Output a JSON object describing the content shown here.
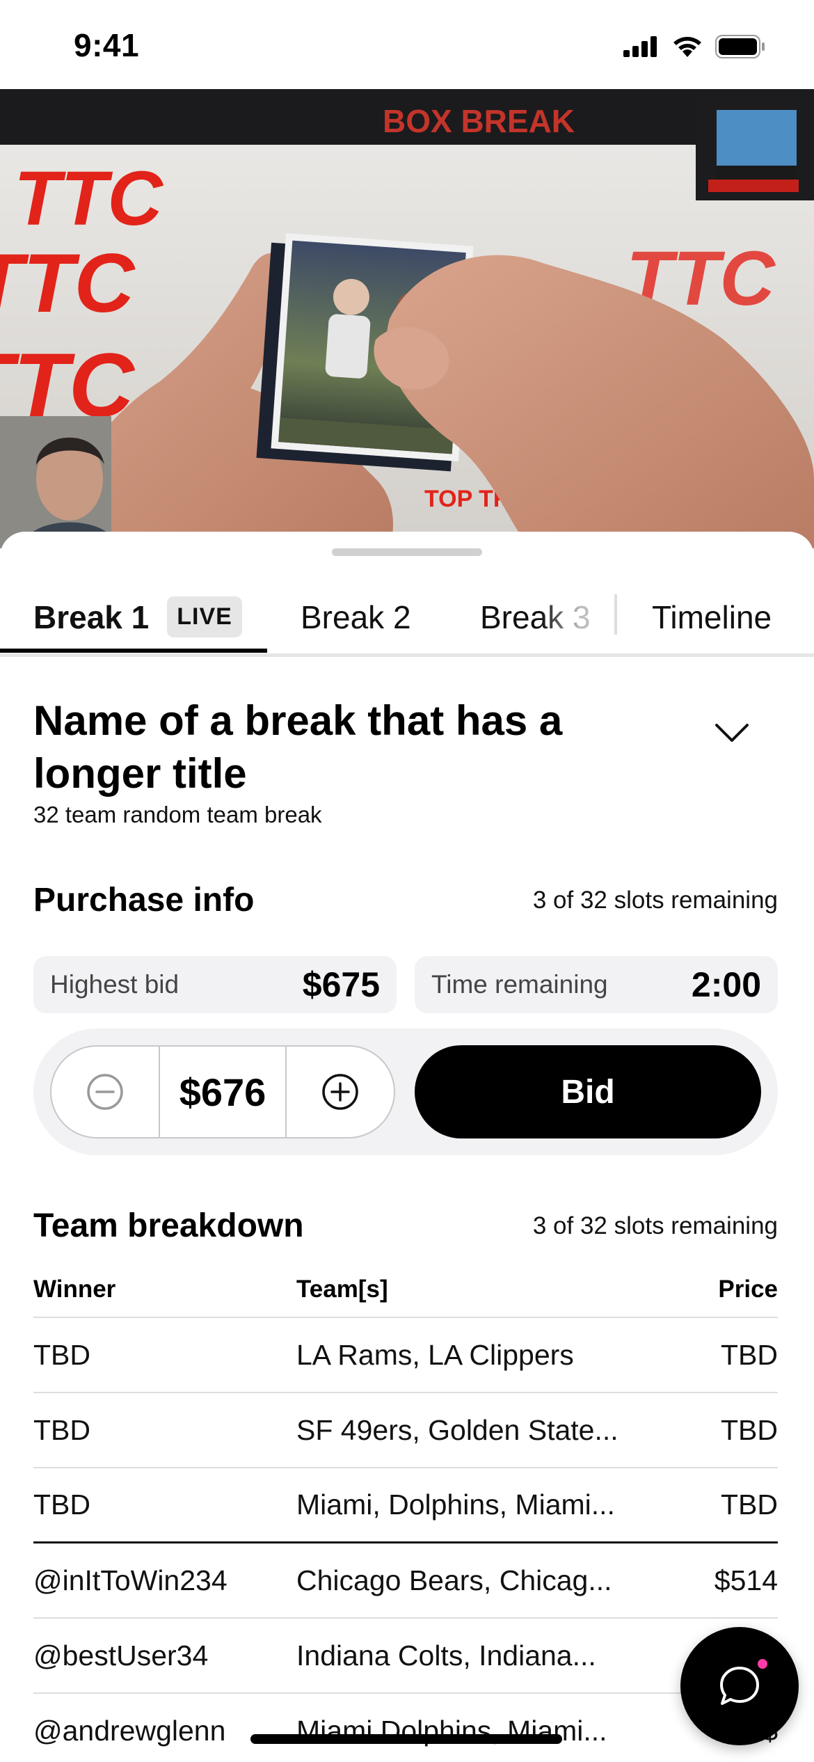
{
  "status_bar": {
    "time": "9:41",
    "icons": [
      "cellular-signal-icon",
      "wifi-icon",
      "battery-icon"
    ]
  },
  "video": {
    "description_icons": [
      "streamer-avatar",
      "product-box-thumbnail"
    ],
    "overlay_text": {
      "banner": "BOX BREAK",
      "logo": "TTC",
      "tagline": "TOP TRADING CARDS"
    }
  },
  "tabs": [
    {
      "label": "Break 1",
      "badge": "LIVE",
      "active": true
    },
    {
      "label": "Break 2",
      "active": false
    },
    {
      "label": "Break 3",
      "active": false
    },
    {
      "label": "Timeline",
      "active": false
    }
  ],
  "break": {
    "title": "Name of a break that has a longer title",
    "subtitle": "32 team random team break"
  },
  "purchase": {
    "title": "Purchase info",
    "slots": "3 of 32 slots remaining",
    "highest_bid_label": "Highest bid",
    "highest_bid_value": "$675",
    "time_label": "Time remaining",
    "time_value": "2:00",
    "bid_amount": "$676",
    "bid_button": "Bid"
  },
  "breakdown": {
    "title": "Team breakdown",
    "slots": "3 of 32 slots remaining",
    "columns": [
      "Winner",
      "Team[s]",
      "Price"
    ],
    "rows": [
      [
        "TBD",
        "LA Rams, LA Clippers",
        "TBD"
      ],
      [
        "TBD",
        "SF 49ers, Golden State...",
        "TBD"
      ],
      [
        "TBD",
        "Miami, Dolphins, Miami...",
        "TBD"
      ],
      [
        "@inItToWin234",
        "Chicago Bears, Chicag...",
        "$514"
      ],
      [
        "@bestUser34",
        "Indiana Colts, Indiana...",
        "$"
      ],
      [
        "@andrewglenn",
        "Miami Dolphins, Miami...",
        "$"
      ]
    ]
  },
  "colors": {
    "accent": "#000000",
    "pill_bg": "#f2f2f5",
    "chat_dot": "#ff3da6",
    "brand_red": "#e2231a"
  }
}
